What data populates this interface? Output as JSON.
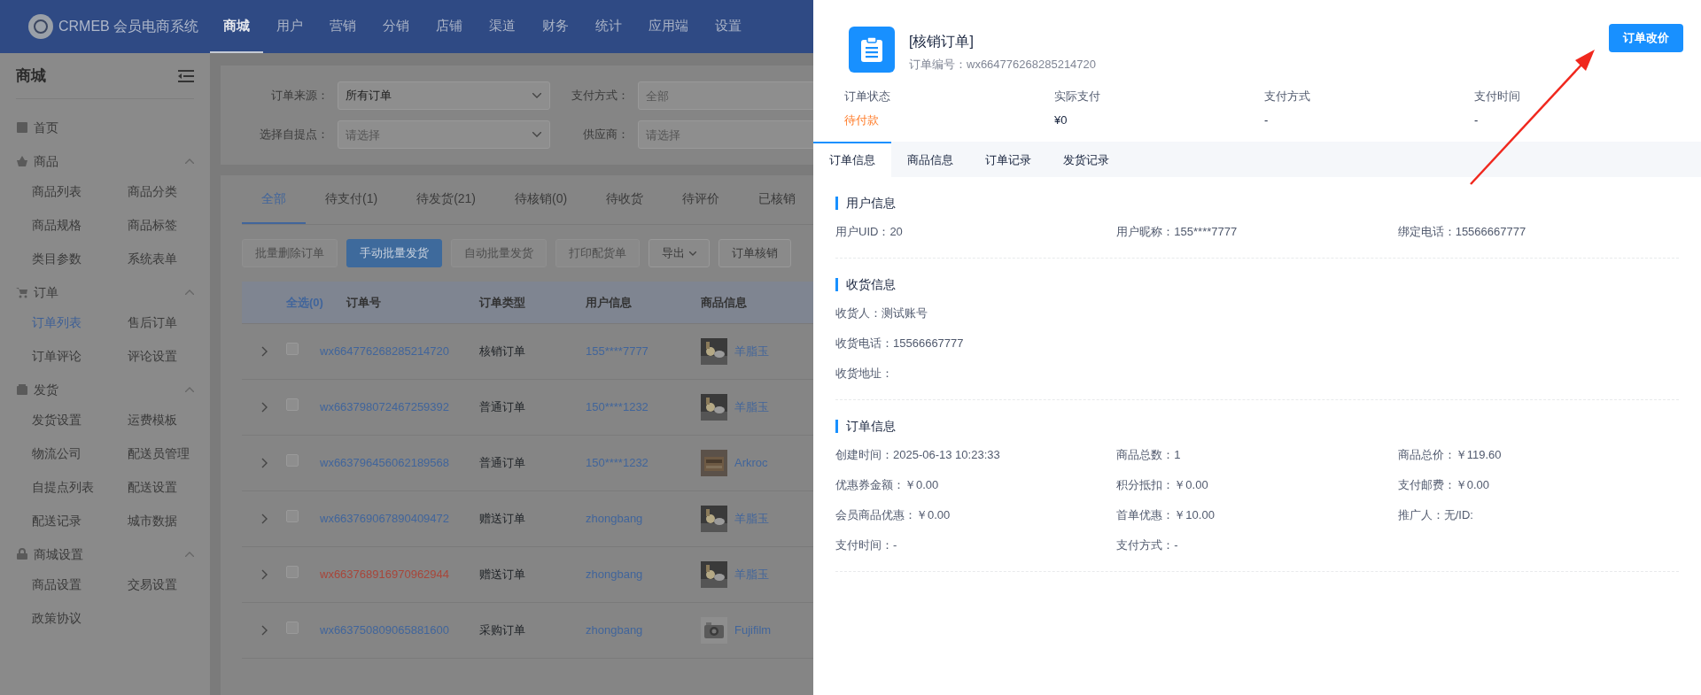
{
  "header": {
    "logo_text": "CRMEB 会员电商系统",
    "nav": [
      {
        "label": "商城",
        "selected": true
      },
      {
        "label": "用户",
        "selected": false
      },
      {
        "label": "营销",
        "selected": false
      },
      {
        "label": "分销",
        "selected": false
      },
      {
        "label": "店铺",
        "selected": false
      },
      {
        "label": "渠道",
        "selected": false
      },
      {
        "label": "财务",
        "selected": false
      },
      {
        "label": "统计",
        "selected": false
      },
      {
        "label": "应用端",
        "selected": false
      },
      {
        "label": "设置",
        "selected": false
      }
    ]
  },
  "sidebar": {
    "title": "商城",
    "items": [
      {
        "kind": "link",
        "label": "首页"
      },
      {
        "kind": "group",
        "label": "商品",
        "expanded": true,
        "children": [
          {
            "label": "商品列表",
            "selected": false
          },
          {
            "label": "商品分类",
            "selected": false
          },
          {
            "label": "商品规格",
            "selected": false
          },
          {
            "label": "商品标签",
            "selected": false
          },
          {
            "label": "类目参数",
            "selected": false
          },
          {
            "label": "系统表单",
            "selected": false
          }
        ]
      },
      {
        "kind": "group",
        "label": "订单",
        "expanded": true,
        "children": [
          {
            "label": "订单列表",
            "selected": true
          },
          {
            "label": "售后订单",
            "selected": false
          },
          {
            "label": "订单评论",
            "selected": false
          },
          {
            "label": "评论设置",
            "selected": false
          }
        ]
      },
      {
        "kind": "group",
        "label": "发货",
        "expanded": true,
        "children": [
          {
            "label": "发货设置",
            "selected": false
          },
          {
            "label": "运费模板",
            "selected": false
          },
          {
            "label": "物流公司",
            "selected": false
          },
          {
            "label": "配送员管理",
            "selected": false
          },
          {
            "label": "自提点列表",
            "selected": false
          },
          {
            "label": "配送设置",
            "selected": false
          },
          {
            "label": "配送记录",
            "selected": false
          },
          {
            "label": "城市数据",
            "selected": false
          }
        ]
      },
      {
        "kind": "group",
        "label": "商城设置",
        "expanded": true,
        "children": [
          {
            "label": "商品设置",
            "selected": false
          },
          {
            "label": "交易设置",
            "selected": false
          },
          {
            "label": "政策协议",
            "selected": false
          }
        ]
      }
    ]
  },
  "filters": [
    {
      "label": "订单来源：",
      "value": "所有订单",
      "kind": "select"
    },
    {
      "label": "支付方式：",
      "placeholder": "全部",
      "kind": "input"
    },
    {
      "label": "选择自提点：",
      "placeholder": "请选择",
      "kind": "select"
    },
    {
      "label": "供应商：",
      "placeholder": "请选择",
      "kind": "input"
    }
  ],
  "order_tabs": [
    {
      "label": "全部",
      "selected": true
    },
    {
      "label": "待支付(1)",
      "selected": false
    },
    {
      "label": "待发货(21)",
      "selected": false
    },
    {
      "label": "待核销(0)",
      "selected": false
    },
    {
      "label": "待收货",
      "selected": false
    },
    {
      "label": "待评价",
      "selected": false
    },
    {
      "label": "已核销",
      "selected": false
    }
  ],
  "actions": [
    {
      "label": "批量删除订单",
      "kind": "disabled"
    },
    {
      "label": "手动批量发货",
      "kind": "primary"
    },
    {
      "label": "自动批量发货",
      "kind": "disabled"
    },
    {
      "label": "打印配货单",
      "kind": "disabled"
    },
    {
      "label": "导出",
      "kind": "dropdown"
    },
    {
      "label": "订单核销",
      "kind": "default"
    }
  ],
  "table": {
    "select_all": "全选(0)",
    "columns": [
      "订单号",
      "订单类型",
      "用户信息",
      "商品信息"
    ],
    "rows": [
      {
        "checked": false,
        "order_no": "wx664776268285214720",
        "color": "#41659b",
        "type": "核销订单",
        "user": "155****7777",
        "product": "羊脂玉"
      },
      {
        "checked": false,
        "order_no": "wx663798072467259392",
        "color": "#41659b",
        "type": "普通订单",
        "user": "150****1232",
        "product": "羊脂玉"
      },
      {
        "checked": false,
        "order_no": "wx663796456062189568",
        "color": "#41659b",
        "type": "普通订单",
        "user": "150****1232",
        "product": "Arkroc"
      },
      {
        "checked": false,
        "order_no": "wx663769067890409472",
        "color": "#41659b",
        "type": "赠送订单",
        "user": "zhongbang",
        "product": "羊脂玉"
      },
      {
        "checked": false,
        "order_no": "wx663768916970962944",
        "color": "#a8463a",
        "type": "赠送订单",
        "user": "zhongbang",
        "product": "羊脂玉"
      },
      {
        "checked": false,
        "order_no": "wx663750809065881600",
        "color": "#41659b",
        "type": "采购订单",
        "user": "zhongbang",
        "product": "Fujifilm"
      }
    ]
  },
  "drawer": {
    "title": "[核销订单]",
    "order_no": "订单编号：wx664776268285214720",
    "button": "订单改价",
    "summary": [
      {
        "label": "订单状态",
        "value": "待付款",
        "kind": "status"
      },
      {
        "label": "实际支付",
        "value": "¥0",
        "kind": "plain"
      },
      {
        "label": "支付方式",
        "value": "-",
        "kind": "plain"
      },
      {
        "label": "支付时间",
        "value": "-",
        "kind": "plain"
      }
    ],
    "tabs": [
      {
        "label": "订单信息",
        "selected": true
      },
      {
        "label": "商品信息",
        "selected": false
      },
      {
        "label": "订单记录",
        "selected": false
      },
      {
        "label": "发货记录",
        "selected": false
      }
    ],
    "sections": [
      {
        "title": "用户信息",
        "kind": "grid",
        "fields": [
          "用户UID：20",
          "用户昵称：155****7777",
          "绑定电话：15566667777"
        ]
      },
      {
        "title": "收货信息",
        "kind": "list",
        "fields": [
          "收货人：测试账号",
          "收货电话：15566667777",
          "收货地址："
        ]
      },
      {
        "title": "订单信息",
        "kind": "grid",
        "fields": [
          "创建时间：2025-06-13 10:23:33",
          "商品总数：1",
          "商品总价：￥119.60",
          "优惠券金额：￥0.00",
          "积分抵扣：￥0.00",
          "支付邮费：￥0.00",
          "会员商品优惠：￥0.00",
          "首单优惠：￥10.00",
          "推广人：无/ID:",
          "支付时间：-",
          "支付方式：-"
        ]
      }
    ]
  }
}
